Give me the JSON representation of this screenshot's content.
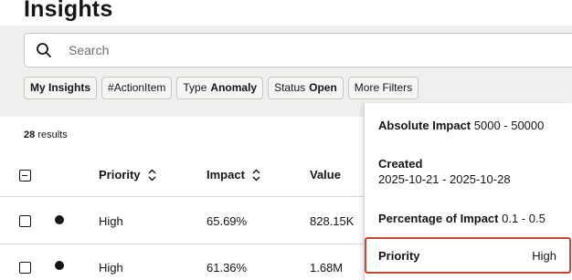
{
  "page": {
    "title": "Insights"
  },
  "search": {
    "placeholder": "Search"
  },
  "chips": [
    {
      "label": "My Insights",
      "value": ""
    },
    {
      "label": "#ActionItem",
      "value": ""
    },
    {
      "label": "Type",
      "value": "Anomaly"
    },
    {
      "label": "Status",
      "value": "Open"
    },
    {
      "label": "More Filters",
      "value": ""
    }
  ],
  "results": {
    "count": "28",
    "label": "results"
  },
  "table": {
    "columns": [
      "Priority",
      "Impact",
      "Value"
    ],
    "rows": [
      {
        "priority": "High",
        "impact": "65.69%",
        "value": "828.15K"
      },
      {
        "priority": "High",
        "impact": "61.36%",
        "value": "1.68M"
      }
    ]
  },
  "filter_panel": {
    "absolute_impact": {
      "label": "Absolute Impact",
      "value": "5000 - 50000"
    },
    "created": {
      "label": "Created",
      "value": "2025-10-21 - 2025-10-28"
    },
    "percentage_impact": {
      "label": "Percentage of Impact",
      "value": "0.1 - 0.5"
    },
    "priority": {
      "label": "Priority",
      "value": "High"
    }
  },
  "colors": {
    "accent_border": "#c74634",
    "band": "#f1efed"
  }
}
